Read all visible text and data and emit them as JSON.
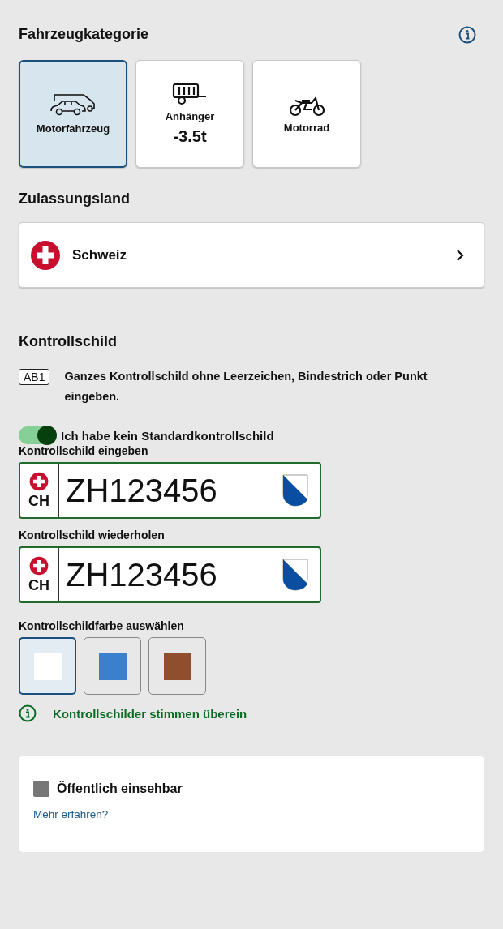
{
  "vehicle_category": {
    "title": "Fahrzeugkategorie",
    "options": [
      {
        "kind": "car",
        "label": "Motorfahrzeug",
        "selected": true
      },
      {
        "kind": "trailer",
        "label": "Anhänger",
        "sublabel": "-3.5t",
        "selected": false
      },
      {
        "kind": "motorcycle",
        "label": "Motorrad",
        "selected": false
      }
    ]
  },
  "registration_country": {
    "title": "Zulassungsland",
    "value": "Schweiz"
  },
  "plate": {
    "title": "Kontrollschild",
    "icon_text": "AB1",
    "hint": "Ganzes Kontrollschild ohne Leerzeichen, Bindestrich oder Punkt eingeben.",
    "toggle": {
      "label": "Ich habe kein Standardkontrollschild",
      "on": true
    },
    "fields": [
      {
        "label": "Kontrollschild eingeben",
        "country_code": "CH",
        "value": "ZH123456"
      },
      {
        "label": "Kontrollschild wiederholen",
        "country_code": "CH",
        "value": "ZH123456"
      }
    ],
    "color_title": "Kontrollschildfarbe auswählen",
    "colors": [
      {
        "color": "#ffffff",
        "selected": true
      },
      {
        "color": "#3a80cc",
        "selected": false
      },
      {
        "color": "#8f4f2f",
        "selected": false
      }
    ],
    "message": "Kontrollschilder stimmen überein"
  },
  "visibility": {
    "label": "Öffentlich einsehbar",
    "checked": false,
    "link": "Mehr erfahren?"
  }
}
